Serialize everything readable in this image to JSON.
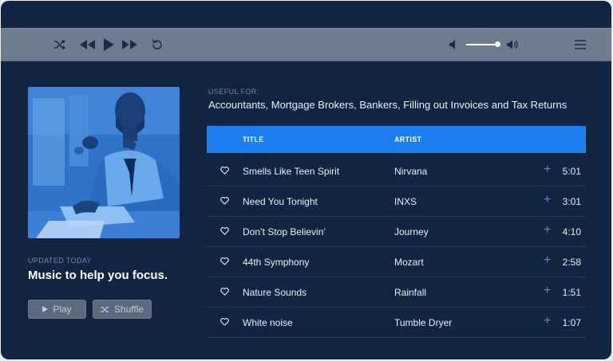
{
  "colors": {
    "window_bg": "#112542",
    "toolbar_bg": "#6e7c90",
    "accent": "#1c7ff0",
    "plus": "#3d8ff5",
    "muted": "#6f86a6",
    "text": "#e8eef7"
  },
  "player": {
    "controls": [
      "shuffle-icon",
      "rewind-icon",
      "play-icon",
      "fast-forward-icon",
      "repeat-icon"
    ],
    "volume_level": 0.9,
    "menu_icon": "hamburger-menu-icon"
  },
  "playlist": {
    "updated": "UPDATED TODAY",
    "title": "Music to help you focus.",
    "play_label": "Play",
    "shuffle_label": "Shuffle"
  },
  "useful": {
    "label": "USEFUL FOR:",
    "text": "Accountants, Mortgage Brokers, Bankers, Filling out Invoices and Tax Returns"
  },
  "table": {
    "headers": {
      "title": "TITLE",
      "artist": "ARTIST"
    },
    "rows": [
      {
        "title": "Smells Like Teen Spirit",
        "artist": "Nirvana",
        "duration": "5:01"
      },
      {
        "title": "Need You Tonight",
        "artist": "INXS",
        "duration": "3:01"
      },
      {
        "title": "Don’t Stop Believin’",
        "artist": "Journey",
        "duration": "4:10"
      },
      {
        "title": "44th Symphony",
        "artist": "Mozart",
        "duration": "2:58"
      },
      {
        "title": "Nature Sounds",
        "artist": "Rainfall",
        "duration": "1:51"
      },
      {
        "title": "White noise",
        "artist": "Tumble Dryer",
        "duration": "1:07"
      }
    ]
  }
}
